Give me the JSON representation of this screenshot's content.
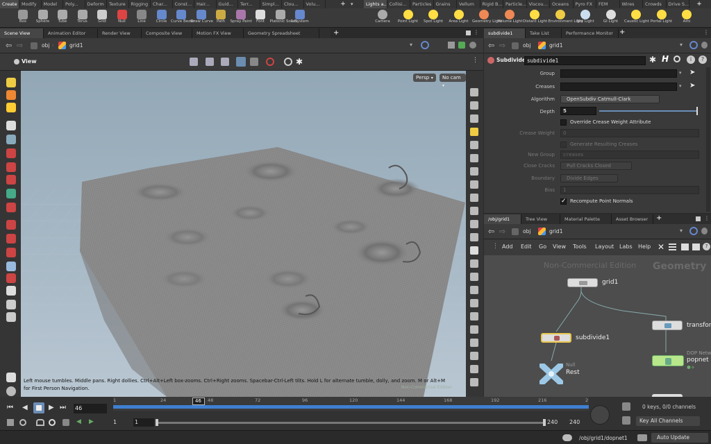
{
  "shelf_tabs_left": [
    "Create",
    "Modify",
    "Model",
    "Poly...",
    "Deform",
    "Texture",
    "Rigging",
    "Char...",
    "Const...",
    "Hair...",
    "Guid...",
    "Terr...",
    "Simpl...",
    "Clou...",
    "Volu..."
  ],
  "shelf_tabs_right": [
    "Lights a...",
    "Collisi...",
    "Particles",
    "Grains",
    "Vellum",
    "Rigid B...",
    "Particle...",
    "Viscou...",
    "Oceans",
    "Pyro FX",
    "FEM",
    "Wires",
    "Crowds",
    "Drive S..."
  ],
  "tools_left": [
    "Box",
    "Sphere",
    "Tube",
    "Torus",
    "Grid",
    "Null",
    "Line",
    "Circle",
    "Curve Bezier",
    "Draw Curve",
    "Path",
    "Spray Paint",
    "Font",
    "Platonic Solids",
    "L-System"
  ],
  "tools_right": [
    "Camera",
    "Point Light",
    "Spot Light",
    "Area Light",
    "Geometry Light",
    "Volume Light",
    "Distant Light",
    "Environment Light",
    "Sky Light",
    "GI Light",
    "Caustic Light",
    "Portal Light",
    "Ami"
  ],
  "left_pane_tabs": [
    "Scene View",
    "Animation Editor",
    "Render View",
    "Composite View",
    "Motion FX View",
    "Geometry Spreadsheet"
  ],
  "right_top_tabs": [
    "subdivide1",
    "Take List",
    "Performance Monitor"
  ],
  "right_bottom_tabs": [
    "/obj/grid1",
    "Tree View",
    "Material Palette",
    "Asset Browser"
  ],
  "viewport": {
    "path_obj": "obj",
    "path_node": "grid1",
    "title": "View",
    "persp": "Persp",
    "cam": "No cam",
    "hint": "Left mouse tumbles. Middle pans. Right dollies. Ctrl+Alt+Left box-zooms. Ctrl+Right zooms. Spacebar-Ctrl-Left tilts. Hold L for alternate tumble, dolly, and zoom.     M or Alt+M for First Person Navigation.",
    "watermark": "Non-Commercial Edition"
  },
  "params": {
    "path_obj": "obj",
    "path_node": "grid1",
    "node_type": "Subdivide",
    "node_name": "subdivide1",
    "group_label": "Group",
    "creases_label": "Creases",
    "algorithm_label": "Algorithm",
    "algorithm_value": "OpenSubdiv Catmull-Clark",
    "depth_label": "Depth",
    "depth_value": "5",
    "depth_fraction": 1.0,
    "override_label": "Override Crease Weight Attribute",
    "crease_weight_label": "Crease Weight",
    "crease_weight_value": "0",
    "generate_label": "Generate Resulting Creases",
    "new_group_label": "New Group",
    "new_group_value": "creases",
    "close_cracks_label": "Close Cracks",
    "close_cracks_value": "Pull Cracks Closed",
    "boundary_label": "Boundary",
    "boundary_value": "Divide Edges",
    "bias_label": "Bias",
    "bias_value": "1",
    "recompute_label": "Recompute Point Normals"
  },
  "network": {
    "path_obj": "obj",
    "path_node": "grid1",
    "menu": [
      "Add",
      "Edit",
      "Go",
      "View",
      "Tools",
      "Layout",
      "Labs",
      "Help"
    ],
    "watermark": "Non-Commercial Edition",
    "context": "Geometry",
    "nodes": {
      "grid": "grid1",
      "subdivide": "subdivide1",
      "null_type": "Null",
      "null_name": "Rest",
      "transform": "transform",
      "dop_type": "DOP Netw",
      "dop_name": "popnet"
    }
  },
  "timeline": {
    "current_frame": "46",
    "ticks": [
      "1",
      "24",
      "48",
      "72",
      "96",
      "120",
      "144",
      "168",
      "192",
      "216",
      "2"
    ],
    "start": "1",
    "range_start": "1",
    "range_end": "240",
    "end": "240",
    "keys_info": "0 keys, 0/0 channels",
    "channels_label": "Key All Channels"
  },
  "status": {
    "path": "/obj/grid1/dopnet1",
    "update_mode": "Auto Update"
  }
}
